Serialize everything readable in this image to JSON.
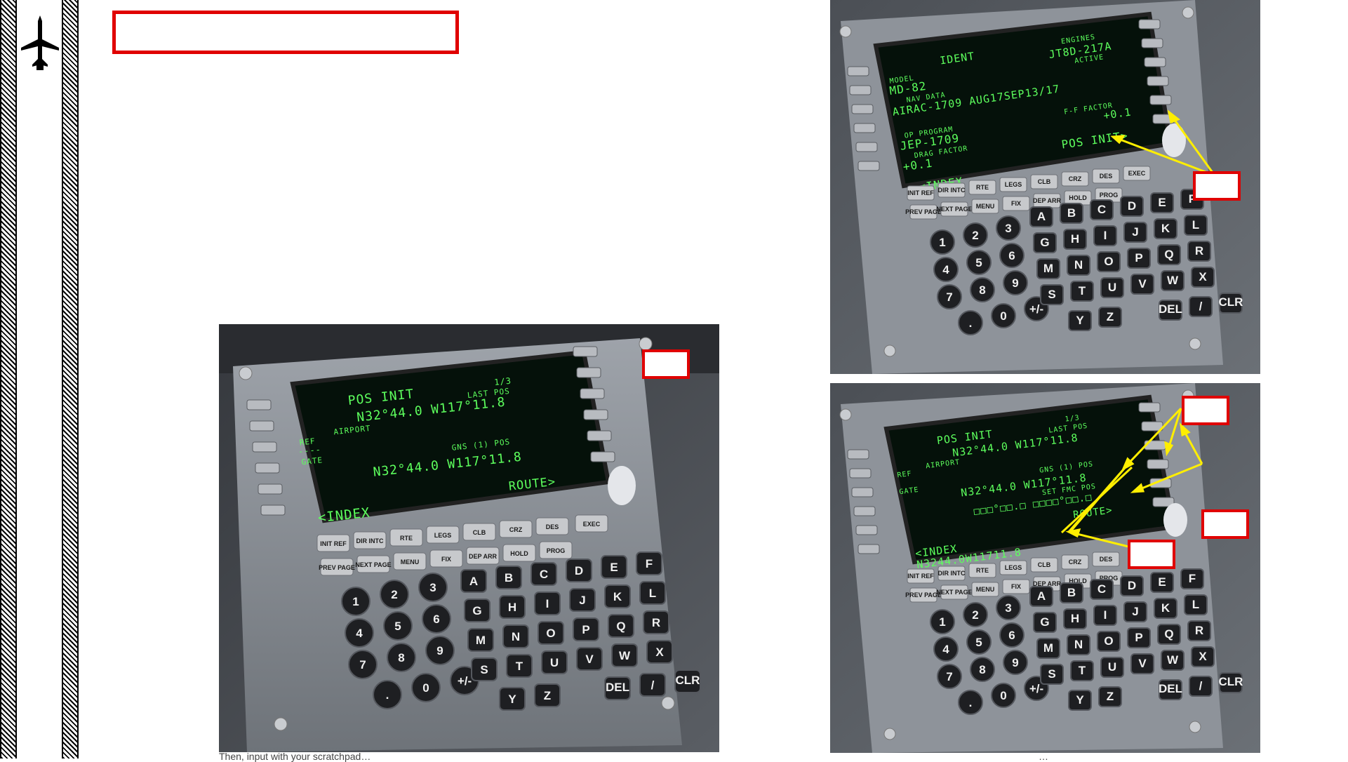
{
  "sidebar": {
    "icon": "airplane-icon"
  },
  "colors": {
    "accent_red": "#e00000",
    "lcd_green": "#5dff5d",
    "callout_yellow": "#ffee00"
  },
  "panel_left": {
    "screen": {
      "title": "POS INIT",
      "page": "1/3",
      "last_pos_label": "LAST POS",
      "last_pos_value": "N32°44.0 W117°11.8",
      "ref_label": "REF",
      "airport_label": "AIRPORT",
      "ref_dashes": "----",
      "gate_label": "GATE",
      "gns_label": "GNS (1) POS",
      "gns_value": "N32°44.0 W117°11.8",
      "index": "<INDEX",
      "route": "ROUTE>"
    }
  },
  "panel_top_right": {
    "screen": {
      "title": "IDENT",
      "engines_label": "ENGINES",
      "model_label": "MODEL",
      "model_value": "MD-82",
      "engines_value": "JT8D-217A",
      "active_label": "ACTIVE",
      "nav_data_label": "NAV DATA",
      "nav_data_value": "AIRAC-1709 AUG17SEP13/17",
      "op_program_label": "OP PROGRAM",
      "op_program_value": "JEP-1709",
      "ff_factor_label": "F-F FACTOR",
      "ff_factor_value": "+0.1",
      "drag_factor_label": "DRAG FACTOR",
      "drag_factor_value": "+0.1",
      "pos_init": "POS INIT>",
      "index": "<INDEX"
    }
  },
  "panel_bottom_right": {
    "screen": {
      "title": "POS INIT",
      "page": "1/3",
      "last_pos_label": "LAST POS",
      "last_pos_value": "N32°44.0 W117°11.8",
      "ref_label": "REF",
      "airport_label": "AIRPORT",
      "gate_label": "GATE",
      "gns_label": "GNS (1) POS",
      "gns_value": "N32°44.0 W117°11.8",
      "set_fmc_label": "SET FMC POS",
      "set_fmc_value": "□□□°□□.□ □□□□°□□.□",
      "route": "ROUTE>",
      "index": "<INDEX",
      "scratchpad": "N3244.0W11711.8"
    }
  },
  "keypad": {
    "func_row1": [
      "INIT REF",
      "DIR INTC",
      "RTE",
      "LEGS",
      "CLB",
      "CRZ",
      "DES",
      "EXEC"
    ],
    "func_row2": [
      "PREV PAGE",
      "NEXT PAGE",
      "MENU",
      "FIX",
      "DEP ARR",
      "HOLD",
      "PROG"
    ],
    "digits": [
      "1",
      "2",
      "3",
      "4",
      "5",
      "6",
      "7",
      "8",
      "9",
      ".",
      "0",
      "+/-"
    ],
    "letters": [
      "A",
      "B",
      "C",
      "D",
      "E",
      "F",
      "G",
      "H",
      "I",
      "J",
      "K",
      "L",
      "M",
      "N",
      "O",
      "P",
      "Q",
      "R",
      "S",
      "T",
      "U",
      "V",
      "W",
      "X",
      "Y",
      "Z",
      "DEL",
      "/",
      "CLR"
    ]
  },
  "caption": {
    "left": "Then, input with your scratchpad…",
    "right": "…"
  }
}
